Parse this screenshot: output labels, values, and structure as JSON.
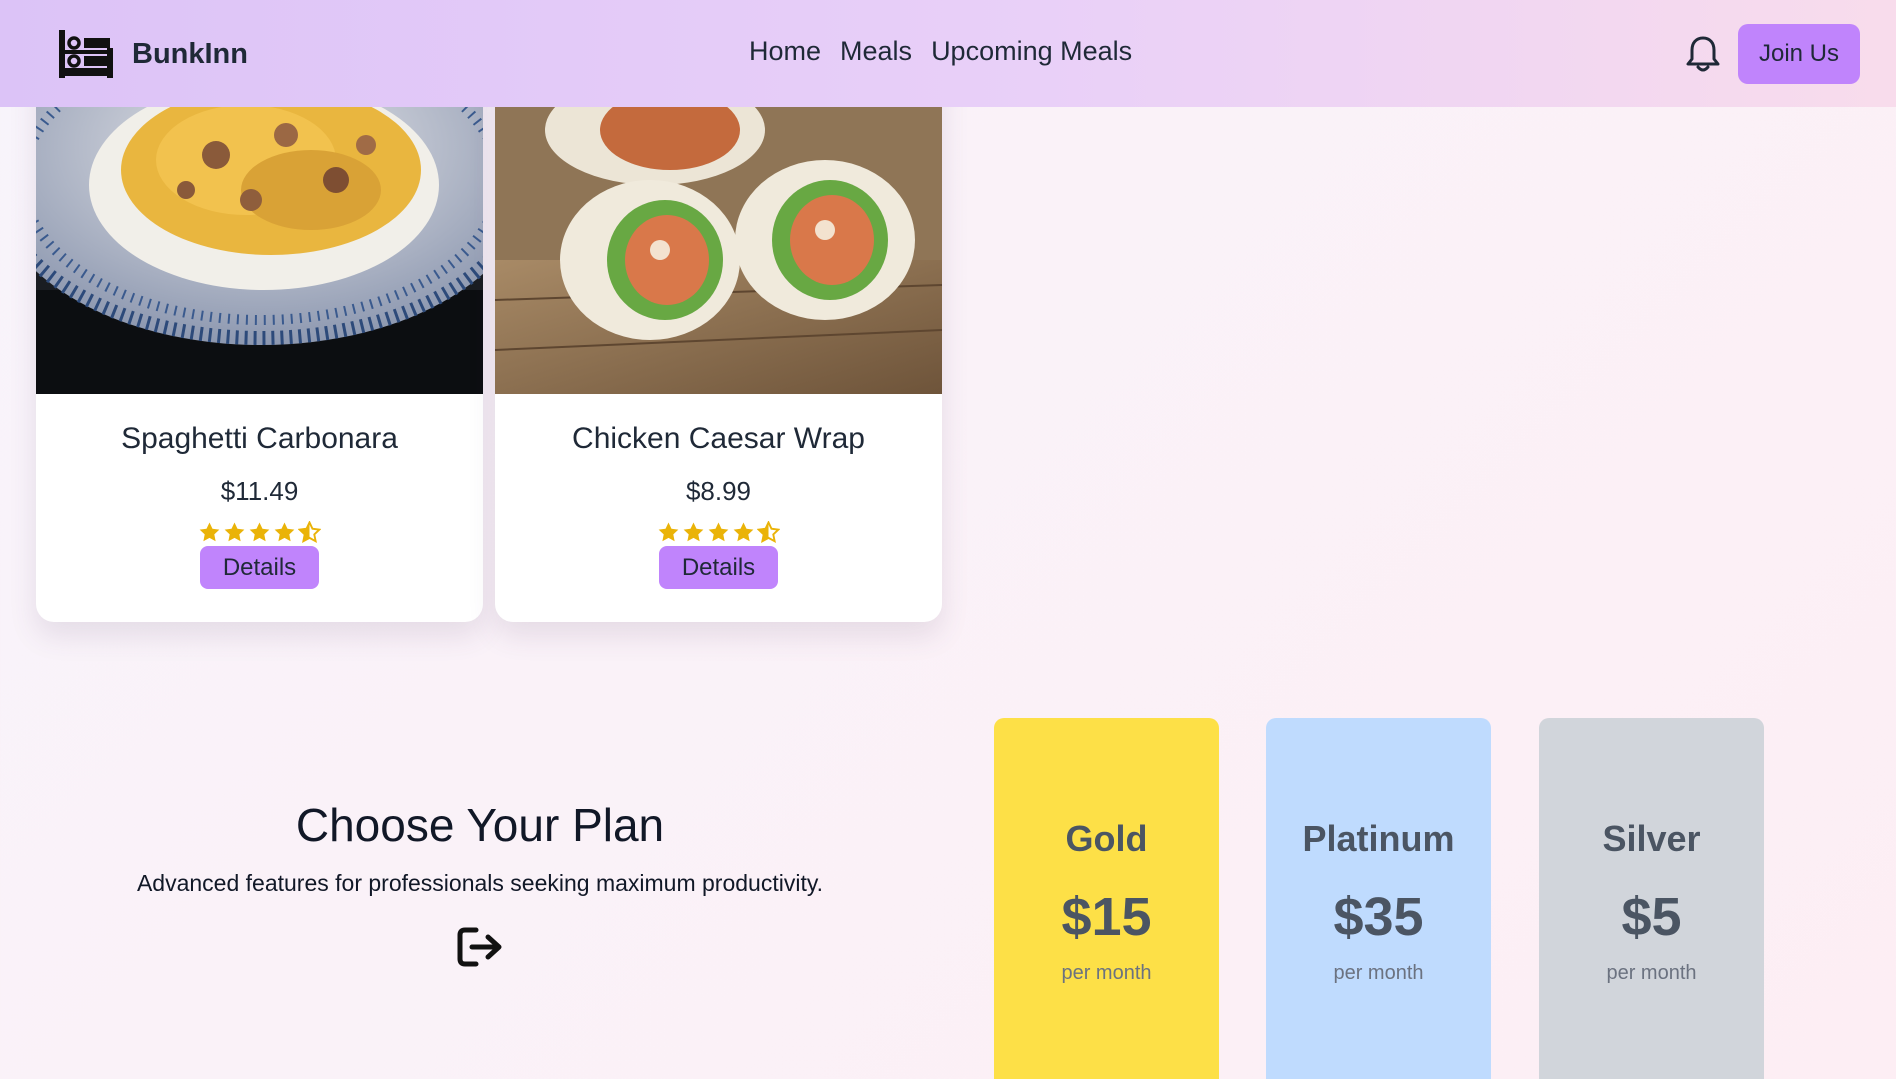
{
  "nav": {
    "brand": "BunkInn",
    "links": [
      "Home",
      "Meals",
      "Upcoming Meals"
    ],
    "join_label": "Join Us"
  },
  "meals": [
    {
      "title": "Spaghetti Carbonara",
      "price": "$11.49",
      "rating": 4.5,
      "details_label": "Details"
    },
    {
      "title": "Chicken Caesar Wrap",
      "price": "$8.99",
      "rating": 4.5,
      "details_label": "Details"
    }
  ],
  "plans_section": {
    "heading": "Choose Your Plan",
    "subheading": "Advanced features for professionals seeking maximum productivity."
  },
  "plans": [
    {
      "name": "Gold",
      "price": "$15",
      "period": "per month",
      "color": "#fde047"
    },
    {
      "name": "Platinum",
      "price": "$35",
      "period": "per month",
      "color": "#bfdbfe"
    },
    {
      "name": "Silver",
      "price": "$5",
      "period": "per month",
      "color": "#d1d5db"
    }
  ],
  "colors": {
    "accent": "#c084fc",
    "star": "#eab308",
    "text": "#1f2937"
  }
}
